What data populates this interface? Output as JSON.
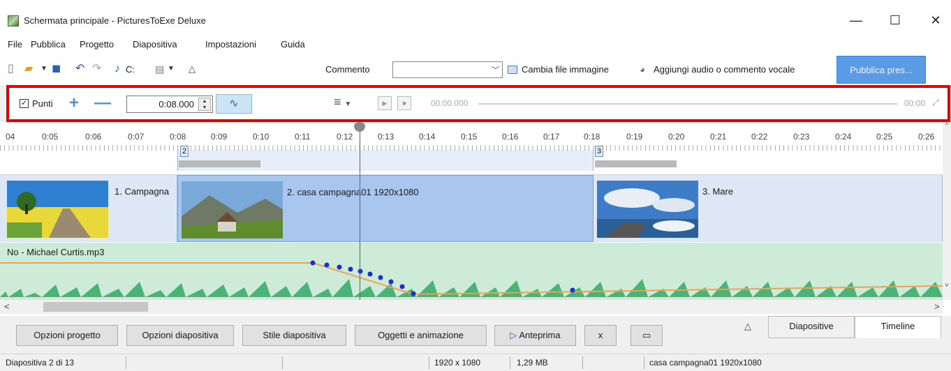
{
  "window": {
    "title": "Schermata principale - PicturesToExe Deluxe",
    "minimize": "—",
    "maximize": "☐",
    "close": "✕"
  },
  "menu": [
    "File",
    "Pubblica",
    "Progetto",
    "Diapositiva",
    "Impostazioni",
    "Guida"
  ],
  "toolbar": {
    "drive_label": "C:",
    "comment_label": "Commento",
    "comment_value": "",
    "change_image_label": "Cambia file immagine",
    "add_audio_label": "Aggiungi audio o commento vocale",
    "publish_label": "Pubblica pres..."
  },
  "keyframes": {
    "points_label": "Punti",
    "points_checked": "✓",
    "time_value": "0:08.000",
    "time_start": "00:00.000",
    "time_end": "00:00"
  },
  "ruler": {
    "ticks": [
      "04",
      "0:05",
      "0:06",
      "0:07",
      "0:08",
      "0:09",
      "0:10",
      "0:11",
      "0:12",
      "0:13",
      "0:14",
      "0:15",
      "0:16",
      "0:17",
      "0:18",
      "0:19",
      "0:20",
      "0:21",
      "0:22",
      "0:23",
      "0:24",
      "0:25",
      "0:26"
    ],
    "badges": [
      "2",
      "3"
    ]
  },
  "slides": [
    {
      "label": "1. Campagna"
    },
    {
      "label": "2. casa campagna01 1920x1080"
    },
    {
      "label": "3. Mare"
    }
  ],
  "audio": {
    "file": "No - Michael Curtis.mp3"
  },
  "buttons": {
    "project_options": "Opzioni progetto",
    "slide_options": "Opzioni diapositiva",
    "slide_style": "Stile diapositiva",
    "objects_animation": "Oggetti e animazione",
    "preview": "Anteprima",
    "x": "x"
  },
  "tabs": {
    "slides": "Diapositive",
    "timeline": "Timeline",
    "active": "Timeline"
  },
  "status": {
    "slide_pos": "Diapositiva 2 di 13",
    "resolution": "1920 x 1080",
    "size": "1,29 MB",
    "file": "casa campagna01 1920x1080"
  },
  "colors": {
    "accent": "#5b9be6",
    "highlight": "#e00000",
    "audio_bg": "#cdebd7",
    "waveform": "#3cae6c",
    "envelope": "#f0a050",
    "point": "#1a2fd0"
  }
}
